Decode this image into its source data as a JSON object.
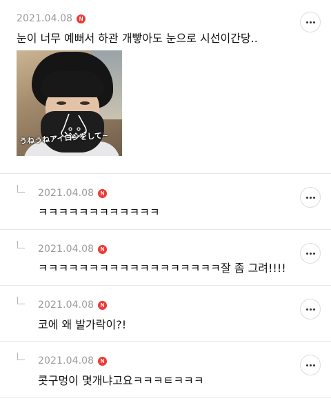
{
  "comments": [
    {
      "date": "2021.04.08",
      "badge": "N",
      "text": "눈이 너무 예뻐서 하관 개빻아도 눈으로 시선이간당..",
      "is_reply": false,
      "image": {
        "caption": "うねうねアイロンをして~"
      }
    },
    {
      "date": "2021.04.08",
      "badge": "N",
      "text": "ㅋㅋㅋㅋㅋㅋㅋㅋㅋㅋㅋㅋ",
      "is_reply": true
    },
    {
      "date": "2021.04.08",
      "badge": "N",
      "text": "ㅋㅋㅋㅋㅋㅋㅋㅋㅋㅋㅋㅋㅋㅋㅋㅋㅋㅋ잘 좀 그려!!!!",
      "is_reply": true
    },
    {
      "date": "2021.04.08",
      "badge": "N",
      "text": "코에 왜 발가락이?!",
      "is_reply": true
    },
    {
      "date": "2021.04.08",
      "badge": "N",
      "text": "콧구멍이 몇개냐고요ㅋㅋㅋㅌㅋㅋㅋ",
      "is_reply": true
    }
  ],
  "icons": {
    "more": "more-horizontal-icon",
    "reply": "reply-corner-icon",
    "new_badge": "new-badge"
  },
  "colors": {
    "badge": "#ee3b36",
    "date": "#9b9b9b",
    "text": "#111111",
    "divider": "#e7e7e7"
  }
}
